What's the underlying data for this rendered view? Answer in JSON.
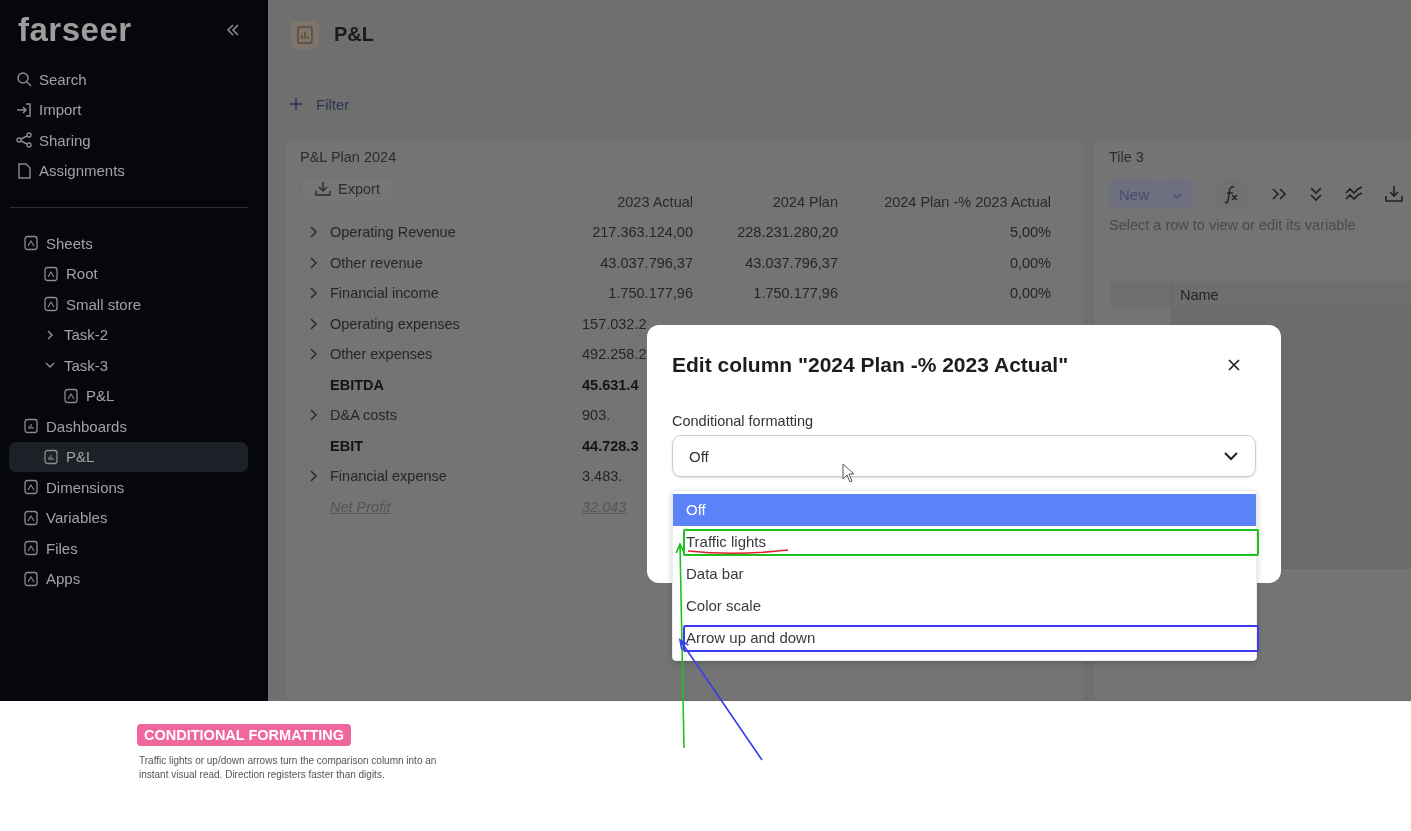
{
  "sidebar": {
    "logo": "farseer",
    "nav": [
      "Search",
      "Import",
      "Sharing",
      "Assignments"
    ],
    "tree": [
      {
        "label": "Sheets",
        "selected": false,
        "children": [
          {
            "label": "Root",
            "selected": false
          },
          {
            "label": "Small store",
            "selected": false
          },
          {
            "label": "Task-2",
            "selected": false,
            "expanded": false
          },
          {
            "label": "Task-3",
            "selected": false,
            "expanded": true,
            "children": [
              {
                "label": "P&L",
                "selected": false
              }
            ]
          }
        ]
      },
      {
        "label": "Dashboards",
        "selected": false,
        "children": [
          {
            "label": "P&L",
            "selected": true
          }
        ]
      },
      {
        "label": "Dimensions",
        "selected": false
      },
      {
        "label": "Variables",
        "selected": false
      },
      {
        "label": "Files",
        "selected": false
      },
      {
        "label": "Apps",
        "selected": false
      }
    ]
  },
  "header": {
    "title": "P&L",
    "filter": "Filter"
  },
  "pl_panel": {
    "title": "P&L Plan 2024",
    "export": "Export",
    "columns": [
      "2023 Actual",
      "2024 Plan",
      "2024 Plan -% 2023 Actual"
    ],
    "rows": [
      {
        "label": "Operating Revenue",
        "kind": "group",
        "values": [
          "217.363.124,00",
          "228.231.280,20",
          "5,00%"
        ]
      },
      {
        "label": "Other revenue",
        "kind": "group",
        "values": [
          "43.037.796,37",
          "43.037.796,37",
          "0,00%"
        ]
      },
      {
        "label": "Financial income",
        "kind": "group",
        "values": [
          "1.750.177,96",
          "1.750.177,96",
          "0,00%"
        ]
      },
      {
        "label": "Operating expenses",
        "kind": "group",
        "values": [
          "157.032.2"
        ]
      },
      {
        "label": "Other expenses",
        "kind": "group",
        "values": [
          "492.258.2"
        ]
      },
      {
        "label": "EBITDA",
        "kind": "total",
        "values": [
          "45.631.4"
        ]
      },
      {
        "label": "D&A costs",
        "kind": "group",
        "values": [
          "903."
        ]
      },
      {
        "label": "EBIT",
        "kind": "total",
        "values": [
          "44.728.3"
        ]
      },
      {
        "label": "Financial expense",
        "kind": "group",
        "values": [
          "3.483."
        ]
      },
      {
        "label": "Net Profit",
        "kind": "net",
        "values": [
          "32.043"
        ]
      }
    ]
  },
  "tile": {
    "title": "Tile 3",
    "new_button": "New",
    "hint": "Select a row to view or edit its variable",
    "column": "Name"
  },
  "modal": {
    "title": "Edit column \"2024 Plan -% 2023 Actual\"",
    "field_label": "Conditional formatting",
    "value": "Off",
    "options": [
      {
        "label": "Off",
        "selected": true
      },
      {
        "label": "Traffic lights",
        "selected": false,
        "color": "#1ec21e"
      },
      {
        "label": "Data bar",
        "selected": false
      },
      {
        "label": "Color scale",
        "selected": false
      },
      {
        "label": "Arrow up and down",
        "selected": false,
        "color": "#3b3bf0"
      }
    ]
  },
  "caption": {
    "badge": "CONDITIONAL FORMATTING",
    "text": "Traffic lights or up/down arrows turn the comparison column into an instant visual read. Direction registers faster than digits."
  }
}
